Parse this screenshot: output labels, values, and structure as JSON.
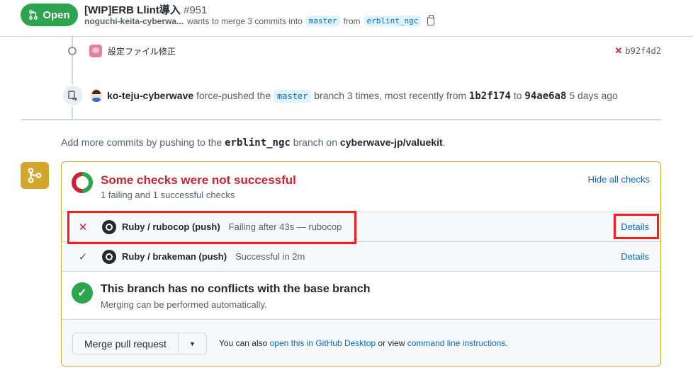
{
  "header": {
    "state": "Open",
    "title": "[WIP]ERB Llint導入",
    "number": "#951",
    "author": "noguchi-keita-cyberwa...",
    "meta_text": "wants to merge 3 commits into",
    "base_branch": "master",
    "from_text": "from",
    "head_branch": "erblint_ngc"
  },
  "timeline": {
    "commit": {
      "message": "設定ファイル修正",
      "status": "✕",
      "sha": "b92f4d2"
    },
    "push": {
      "user": "ko-teju-cyberwave",
      "action": "force-pushed the",
      "branch": "master",
      "text_mid": "branch 3 times, most recently from",
      "from_sha": "1b2f174",
      "to_text": "to",
      "to_sha": "94ae6a8",
      "time": "5 days ago"
    }
  },
  "hint": {
    "prefix": "Add more commits by pushing to the",
    "branch": "erblint_ngc",
    "mid": "branch on",
    "repo": "cyberwave-jp/valuekit",
    "suffix": "."
  },
  "checks": {
    "title": "Some checks were not successful",
    "subtitle": "1 failing and 1 successful checks",
    "hide_label": "Hide all checks",
    "items": [
      {
        "status": "✕",
        "name": "Ruby / rubocop (push)",
        "description": "Failing after 43s — rubocop",
        "details": "Details"
      },
      {
        "status": "✓",
        "name": "Ruby / brakeman (push)",
        "description": "Successful in 2m",
        "details": "Details"
      }
    ]
  },
  "conflicts": {
    "title": "This branch has no conflicts with the base branch",
    "subtitle": "Merging can be performed automatically."
  },
  "merge": {
    "button_label": "Merge pull request",
    "caret": "▼",
    "text_prefix": "You can also",
    "desktop_link": "open this in GitHub Desktop",
    "text_mid": "or view",
    "cli_link": "command line instructions",
    "text_suffix": "."
  },
  "colors": {
    "open_green": "#2da44e",
    "fail_red": "#cf222e",
    "link_blue": "#0969da",
    "warning_border": "#d4a72c",
    "annotation_red": "#ff1a1a"
  }
}
